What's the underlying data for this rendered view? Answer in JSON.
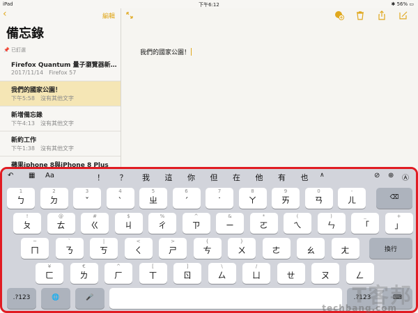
{
  "status": {
    "device": "iPad",
    "time": "下午6:12",
    "battery": "56%"
  },
  "sidebar": {
    "title": "備忘錄",
    "edit_label": "編輯",
    "pinned_label": "已釘選",
    "notes": [
      {
        "title": "Firefox Quantum 量子瀏覽器新…",
        "date": "2017/11/14",
        "preview": "Firefox 57",
        "selected": false
      },
      {
        "title": "我們的國家公園！",
        "date": "下午5:58",
        "preview": "沒有其他文字",
        "selected": true
      },
      {
        "title": "新增備忘錄",
        "date": "下午4:13",
        "preview": "沒有其他文字",
        "selected": false
      },
      {
        "title": "新約工作",
        "date": "下午1:38",
        "preview": "沒有其他文字",
        "selected": false
      },
      {
        "title": "蘋果iphone 8與iPhone 8 Plus",
        "date": "",
        "preview": "",
        "selected": false
      }
    ]
  },
  "note": {
    "body": "我們的國家公園！"
  },
  "keyboard": {
    "candidates": [
      "！",
      "？",
      "我",
      "這",
      "你",
      "但",
      "在",
      "他",
      "有",
      "也"
    ],
    "row1": [
      {
        "main": "ㄅ",
        "sub": "1"
      },
      {
        "main": "ㄉ",
        "sub": "2"
      },
      {
        "main": "ˇ",
        "sub": "3"
      },
      {
        "main": "ˋ",
        "sub": "4"
      },
      {
        "main": "ㄓ",
        "sub": "5"
      },
      {
        "main": "ˊ",
        "sub": "6"
      },
      {
        "main": "˙",
        "sub": "7"
      },
      {
        "main": "ㄚ",
        "sub": "8"
      },
      {
        "main": "ㄞ",
        "sub": "9"
      },
      {
        "main": "ㄢ",
        "sub": "0"
      },
      {
        "main": "ㄦ",
        "sub": "-"
      }
    ],
    "row2": [
      {
        "main": "ㄆ",
        "sub": "!"
      },
      {
        "main": "ㄊ",
        "sub": "@"
      },
      {
        "main": "ㄍ",
        "sub": "#"
      },
      {
        "main": "ㄐ",
        "sub": "$"
      },
      {
        "main": "ㄔ",
        "sub": "%"
      },
      {
        "main": "ㄗ",
        "sub": "^"
      },
      {
        "main": "ㄧ",
        "sub": "&"
      },
      {
        "main": "ㄛ",
        "sub": "*"
      },
      {
        "main": "ㄟ",
        "sub": "("
      },
      {
        "main": "ㄣ",
        "sub": ")"
      },
      {
        "main": "「",
        "sub": "_"
      },
      {
        "main": "」",
        "sub": "+"
      }
    ],
    "row3": [
      {
        "main": "ㄇ",
        "sub": "~"
      },
      {
        "main": "ㄋ",
        "sub": "`"
      },
      {
        "main": "ㄎ",
        "sub": "|"
      },
      {
        "main": "ㄑ",
        "sub": "<"
      },
      {
        "main": "ㄕ",
        "sub": ">"
      },
      {
        "main": "ㄘ",
        "sub": "{"
      },
      {
        "main": "ㄨ",
        "sub": "}"
      },
      {
        "main": "ㄜ",
        "sub": ""
      },
      {
        "main": "ㄠ",
        "sub": ""
      },
      {
        "main": "ㄤ",
        "sub": ""
      }
    ],
    "row4": [
      {
        "main": "ㄈ",
        "sub": "¥"
      },
      {
        "main": "ㄌ",
        "sub": "€"
      },
      {
        "main": "ㄏ",
        "sub": "^"
      },
      {
        "main": "ㄒ",
        "sub": "["
      },
      {
        "main": "ㄖ",
        "sub": "]"
      },
      {
        "main": "ㄙ",
        "sub": "\\"
      },
      {
        "main": "ㄩ",
        "sub": "/"
      },
      {
        "main": "ㄝ",
        "sub": ""
      },
      {
        "main": "ㄡ",
        "sub": ""
      },
      {
        "main": "ㄥ",
        "sub": ""
      }
    ],
    "return_label": "換行",
    "num_label": ".?123",
    "num_label_right": ".?123",
    "emoji_label": "Aa"
  },
  "watermark": {
    "big": "T客邦",
    "small": "techbang.com"
  }
}
